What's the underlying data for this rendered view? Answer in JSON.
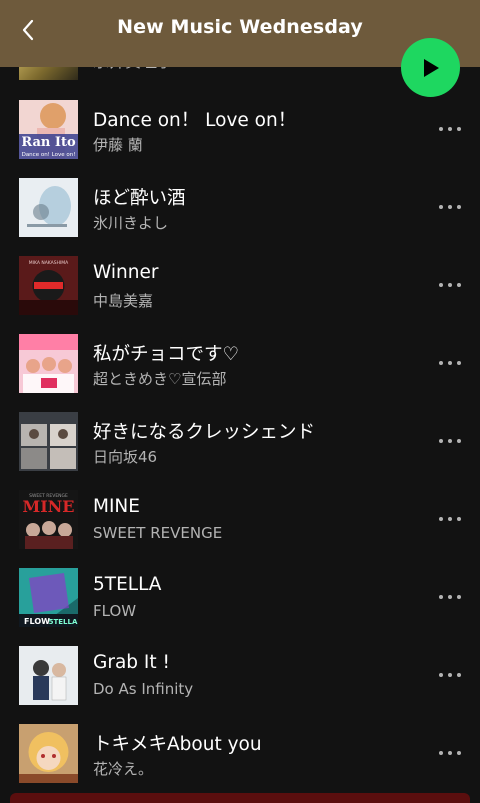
{
  "header": {
    "title": "New Music Wednesday",
    "back_icon": "chevron-left-icon",
    "play_icon": "play-icon",
    "play_color": "#1ed760"
  },
  "peek_track": {
    "artist": "永井真理子"
  },
  "tracks": [
    {
      "title": "Dance on！ Love on！",
      "artist": "伊藤 蘭"
    },
    {
      "title": "ほど酔い酒",
      "artist": "氷川きよし"
    },
    {
      "title": "Winner",
      "artist": "中島美嘉"
    },
    {
      "title": "私がチョコです♡",
      "artist": "超ときめき♡宣伝部"
    },
    {
      "title": "好きになるクレッシェンド",
      "artist": "日向坂46"
    },
    {
      "title": "MINE",
      "artist": "SWEET REVENGE"
    },
    {
      "title": "5TELLA",
      "artist": "FLOW"
    },
    {
      "title": "Grab It !",
      "artist": "Do As Infinity"
    },
    {
      "title": "トキメキAbout you",
      "artist": "花冷え。"
    }
  ],
  "art_texts": {
    "t0": "Ran Ito",
    "t0_sub": "Dance on! Love on!",
    "t2": "MIKA NAKASHIMA",
    "t5": "MINE",
    "t5_sub": "SWEET REVENGE",
    "t6": "FLOW",
    "t6_sub": "5TELLA"
  },
  "more_icon": "more-horizontal-icon"
}
